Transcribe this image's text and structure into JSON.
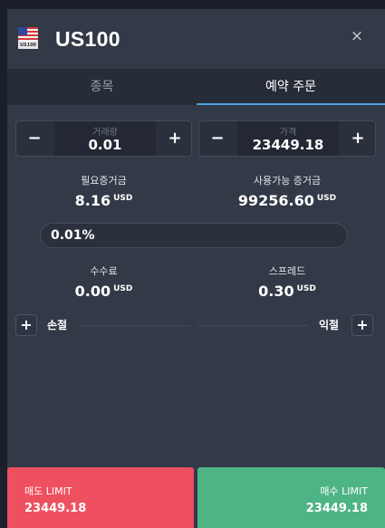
{
  "header": {
    "flag_code": "US100",
    "title": "US100",
    "close_glyph": "×"
  },
  "tabs": [
    {
      "label": "종목",
      "active": false
    },
    {
      "label": "예약 주문",
      "active": true
    }
  ],
  "volume": {
    "label": "거래량",
    "value": "0.01",
    "minus": "−",
    "plus": "+"
  },
  "price": {
    "label": "가격",
    "value": "23449.18",
    "minus": "−",
    "plus": "+"
  },
  "required_margin": {
    "label": "필요증거금",
    "value": "8.16",
    "unit": "USD"
  },
  "available_margin": {
    "label": "사용가능 증거금",
    "value": "99256.60",
    "unit": "USD"
  },
  "percent": {
    "value": "0.01%"
  },
  "fee": {
    "label": "수수료",
    "value": "0.00",
    "unit": "USD"
  },
  "spread": {
    "label": "스프레드",
    "value": "0.30",
    "unit": "USD"
  },
  "stop_loss": {
    "label": "손절",
    "button": "+"
  },
  "take_profit": {
    "label": "익절",
    "button": "+"
  },
  "sell": {
    "label": "매도 LIMIT",
    "price": "23449.18",
    "color": "#ee5060"
  },
  "buy": {
    "label": "매수 LIMIT",
    "price": "23449.18",
    "color": "#4fb485"
  },
  "colors": {
    "accent": "#4aa3df",
    "panel": "#323947",
    "background": "#1f2430"
  }
}
